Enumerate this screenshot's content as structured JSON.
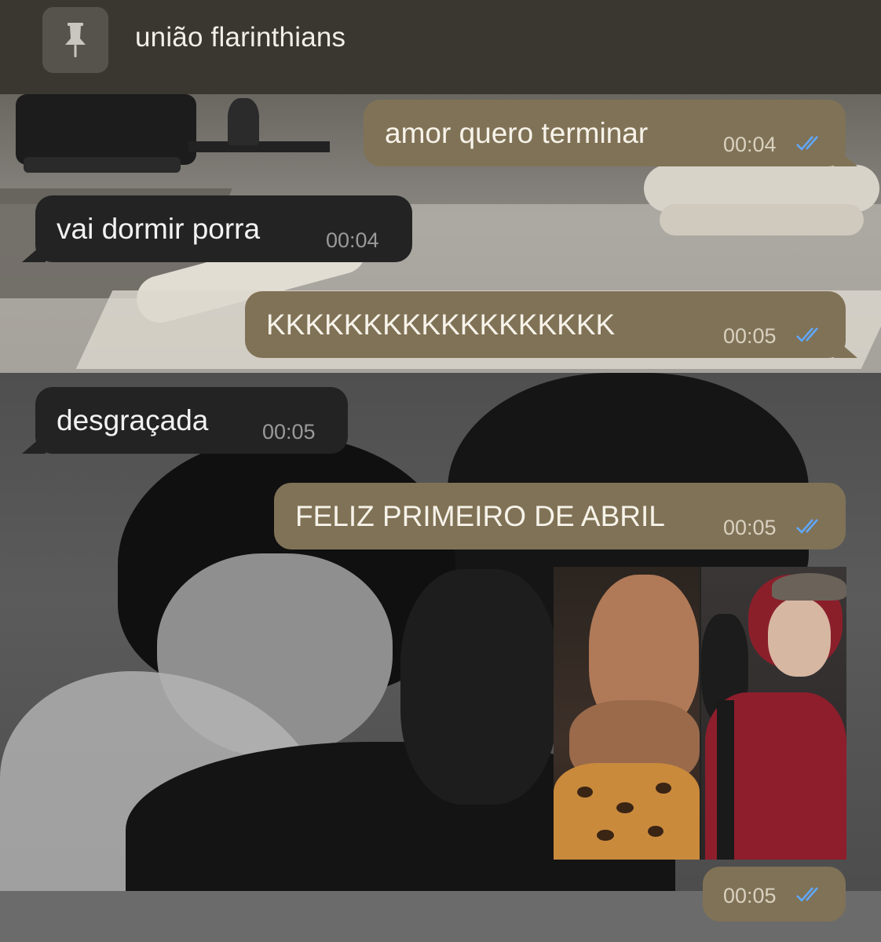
{
  "pinned": {
    "title": "união flarinthians",
    "icon": "pin-icon"
  },
  "messages": [
    {
      "direction": "outgoing",
      "text": "amor quero terminar",
      "time": "00:04",
      "status": "read-double-check"
    },
    {
      "direction": "incoming",
      "text": "vai dormir porra",
      "time": "00:04"
    },
    {
      "direction": "outgoing",
      "text": "KKKKKKKKKKKKKKKKKK",
      "time": "00:05",
      "status": "read-double-check"
    },
    {
      "direction": "incoming",
      "text": "desgraçada",
      "time": "00:05"
    },
    {
      "direction": "outgoing",
      "text": "FELIZ PRIMEIRO DE ABRIL",
      "time": "00:05",
      "status": "read-double-check"
    },
    {
      "direction": "outgoing",
      "type": "image",
      "time": "00:05",
      "status": "read-double-check"
    }
  ],
  "colors": {
    "outgoing_bubble": "#807256",
    "incoming_bubble": "#232323",
    "read_tick": "#5fa8ff",
    "header_bg": "#3a3730"
  }
}
